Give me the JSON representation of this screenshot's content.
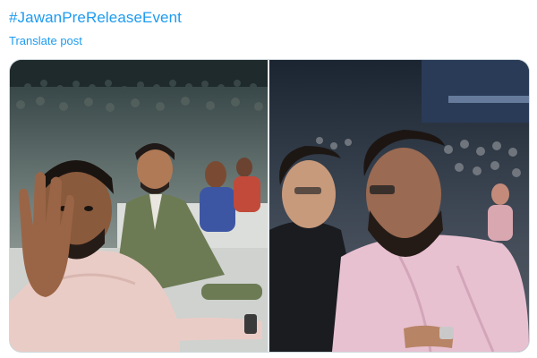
{
  "post": {
    "hashtag": "#JawanPreReleaseEvent",
    "translate_label": "Translate post"
  },
  "media": {
    "photos": [
      {
        "name": "photo-stadium-audience-waving"
      },
      {
        "name": "photo-two-men-embracing"
      }
    ]
  }
}
